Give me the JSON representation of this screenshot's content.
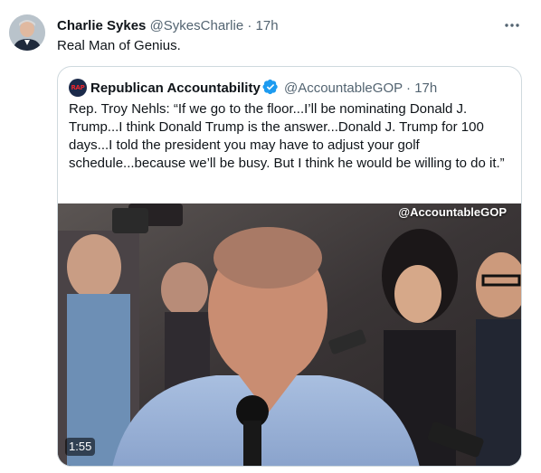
{
  "tweet": {
    "author_name": "Charlie Sykes",
    "author_handle": "@SykesCharlie",
    "separator": "·",
    "time": "17h",
    "text": "Real Man of Genius.",
    "more_icon": "more-horizontal-icon"
  },
  "quote": {
    "avatar_text": "RAP",
    "author_name": "Republican Accountability",
    "verified": true,
    "author_handle": "@AccountableGOP",
    "separator": "·",
    "time": "17h",
    "text": "Rep. Troy Nehls: “If we go to the floor...I’ll be nominating Donald J. Trump...I think Donald Trump is the answer...Donald J. Trump for 100 days...I told the president you may have to adjust your golf schedule...because we’ll be busy. But I think he would be willing to do it.”",
    "video": {
      "watermark": "@AccountableGOP",
      "duration": "1:55"
    }
  },
  "colors": {
    "text_primary": "#0f1419",
    "text_secondary": "#536471",
    "border": "#cfd9de",
    "verified_blue": "#1d9bf0"
  }
}
